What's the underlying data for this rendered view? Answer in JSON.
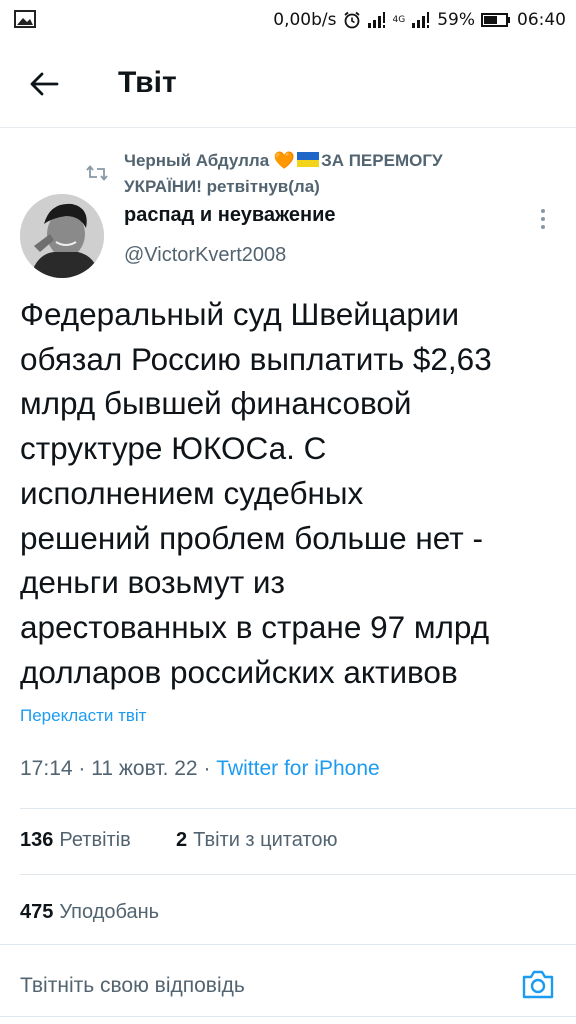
{
  "status_bar": {
    "network_speed": "0,00b/s",
    "lte_label": "4G",
    "battery_percent": "59%",
    "time": "06:40"
  },
  "header": {
    "title": "Твіт",
    "back_icon": "arrow-left-icon"
  },
  "retweet_context": {
    "name_prefix": "Черный Абдулла",
    "heart": "🧡",
    "text_suffix": "ЗА ПЕРЕМОГУ УКРАЇНИ! ретвітнув(ла)",
    "icon": "retweet-icon"
  },
  "author": {
    "display_name": "распад и неуважение",
    "handle": "@VictorKvert2008"
  },
  "tweet": {
    "text": "Федеральный суд Швейцарии\nобязал Россию выплатить $2,63\nмлрд бывшей финансовой\nструктуре ЮКОСа. С\nисполнением судебных\nрешений проблем больше нет -\nденьги возьмут из\nарестованных в стране 97 млрд\nдолларов российских активов",
    "translate_link": "Перекласти твіт",
    "time": "17:14",
    "date": "11 жовт. 22",
    "separator": " · ",
    "client": "Twitter for iPhone"
  },
  "stats": {
    "retweets_count": "136",
    "retweets_label": "Ретвітів",
    "quotes_count": "2",
    "quotes_label": "Твіти з цитатою",
    "likes_count": "475",
    "likes_label": "Уподобань"
  },
  "reply": {
    "placeholder": "Твітніть свою відповідь",
    "camera_icon": "camera-icon"
  },
  "colors": {
    "accent": "#1d9bf0",
    "secondary_text": "#536471",
    "primary_text": "#0f1419"
  }
}
